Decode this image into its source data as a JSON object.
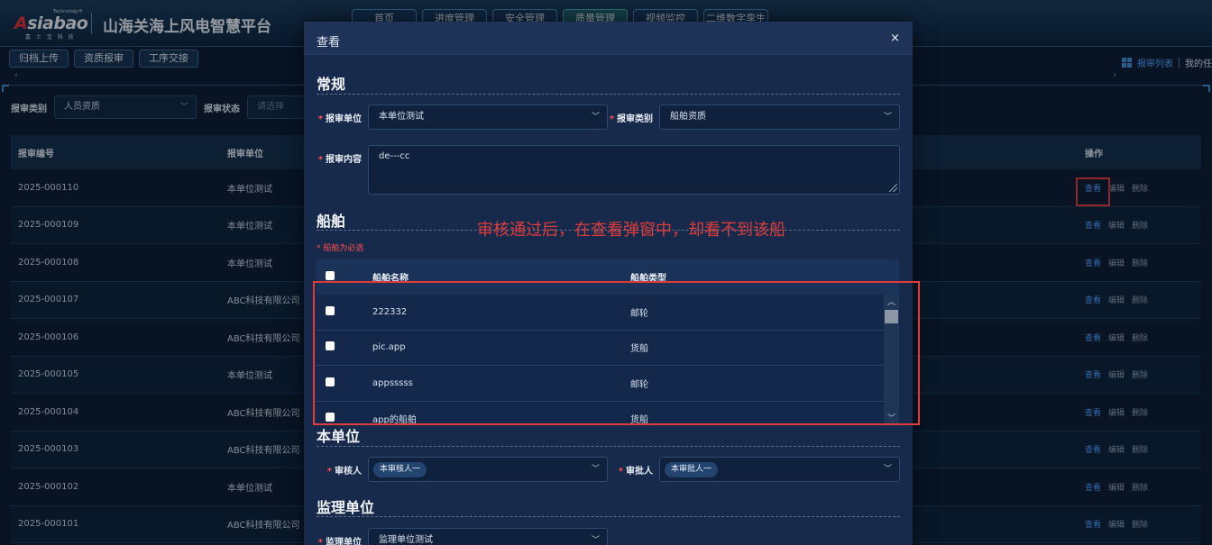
{
  "header": {
    "logo_tech": "Technology®",
    "logo_brand_a": "A",
    "logo_brand_rest": "siabao",
    "logo_sub": "嘉 士 宝 科 技",
    "app_title": "山海关海上风电智慧平台",
    "nav": [
      "首页",
      "进度管理",
      "安全管理",
      "质量管理",
      "视频监控",
      "二维数字孪生"
    ]
  },
  "subtabs": [
    "归档上传",
    "资质报审",
    "工序交接"
  ],
  "tools": {
    "list_label": "报审列表",
    "user_text": "我的任"
  },
  "filters": {
    "type_label": "报审类别",
    "type_value": "人员资质",
    "status_label": "报审状态",
    "status_placeholder": "请选择"
  },
  "table": {
    "headers": {
      "id": "报审编号",
      "unit": "报审单位",
      "ops": "操作"
    },
    "ops": {
      "view": "查看",
      "edit": "编辑",
      "delete": "删除"
    },
    "rows": [
      {
        "id": "2025-000110",
        "unit": "本单位测试"
      },
      {
        "id": "2025-000109",
        "unit": "本单位测试"
      },
      {
        "id": "2025-000108",
        "unit": "本单位测试"
      },
      {
        "id": "2025-000107",
        "unit": "ABC科技有限公司"
      },
      {
        "id": "2025-000106",
        "unit": "ABC科技有限公司"
      },
      {
        "id": "2025-000105",
        "unit": "本单位测试"
      },
      {
        "id": "2025-000104",
        "unit": "ABC科技有限公司"
      },
      {
        "id": "2025-000103",
        "unit": "ABC科技有限公司"
      },
      {
        "id": "2025-000102",
        "unit": "本单位测试"
      },
      {
        "id": "2025-000101",
        "unit": "ABC科技有限公司"
      }
    ]
  },
  "modal": {
    "title": "查看",
    "close": "×",
    "general": {
      "title": "常规",
      "unit_label": "报审单位",
      "unit_value": "本单位测试",
      "type_label": "报审类别",
      "type_value": "船舶资质",
      "content_label": "报审内容",
      "content_value": "de---cc"
    },
    "ships": {
      "title": "船舶",
      "required_note": "* 船舶为必选",
      "col_name": "船舶名称",
      "col_type": "船舶类型",
      "rows": [
        {
          "name": "222332",
          "type": "邮轮"
        },
        {
          "name": "pic.app",
          "type": "货船"
        },
        {
          "name": "appsssss",
          "type": "邮轮"
        },
        {
          "name": "app的船舶",
          "type": "货船"
        }
      ]
    },
    "own_unit": {
      "title": "本单位",
      "reviewer_label": "审核人",
      "reviewer_value": "本审核人一",
      "approver_label": "审批人",
      "approver_value": "本审批人一"
    },
    "supervision": {
      "title": "监理单位",
      "unit_label": "监理单位",
      "unit_value": "监理单位测试"
    }
  },
  "annotation": "审核通过后，在查看弹窗中，却看不到该船",
  "colors": {
    "accent": "#4aa3ff",
    "annotation": "#e03c3c",
    "required": "#ff4d4f"
  }
}
